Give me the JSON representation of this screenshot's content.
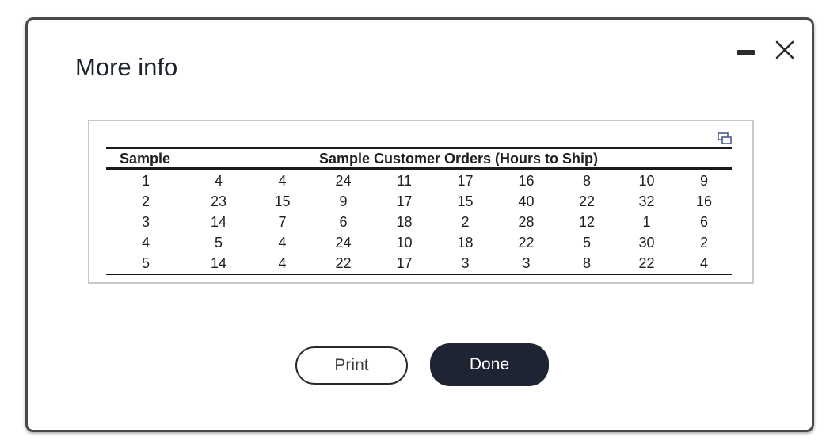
{
  "dialog": {
    "title": "More info"
  },
  "table": {
    "headers": {
      "sample": "Sample",
      "orders": "Sample Customer Orders (Hours to Ship)"
    },
    "rows": [
      {
        "sample": "1",
        "orders": [
          "4",
          "4",
          "24",
          "11",
          "17",
          "16",
          "8",
          "10",
          "9"
        ]
      },
      {
        "sample": "2",
        "orders": [
          "23",
          "15",
          "9",
          "17",
          "15",
          "40",
          "22",
          "32",
          "16"
        ]
      },
      {
        "sample": "3",
        "orders": [
          "14",
          "7",
          "6",
          "18",
          "2",
          "28",
          "12",
          "1",
          "6"
        ]
      },
      {
        "sample": "4",
        "orders": [
          "5",
          "4",
          "24",
          "10",
          "18",
          "22",
          "5",
          "30",
          "2"
        ]
      },
      {
        "sample": "5",
        "orders": [
          "14",
          "4",
          "22",
          "17",
          "3",
          "3",
          "8",
          "22",
          "4"
        ]
      }
    ]
  },
  "buttons": {
    "print_label": "Print",
    "done_label": "Done"
  },
  "icons": {
    "minimize": "minimize-icon",
    "close": "close-icon",
    "popout": "popout-icon"
  },
  "colors": {
    "done_bg": "#1e2433",
    "border": "#4a4a4a"
  }
}
